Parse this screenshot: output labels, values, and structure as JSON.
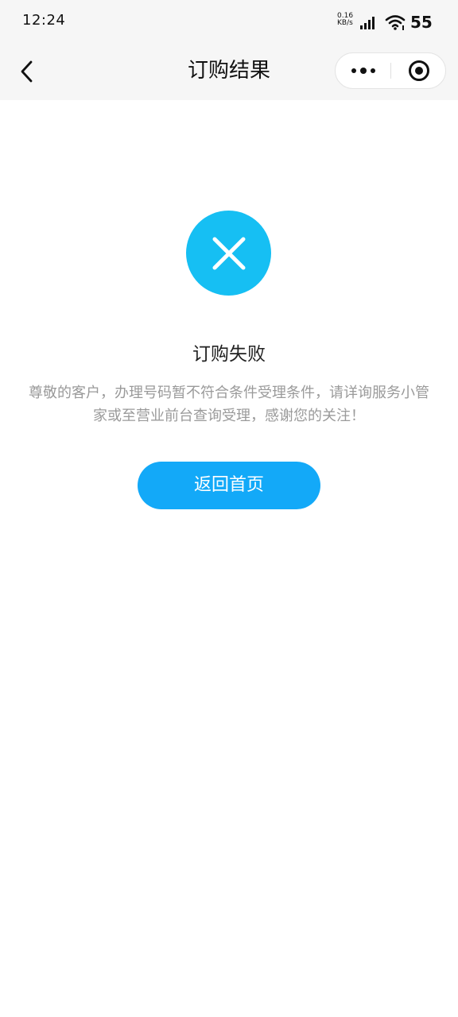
{
  "status_bar": {
    "time": "12:24",
    "net_speed_value": "0.16",
    "net_speed_unit": "KB/s",
    "battery": "55",
    "icons": [
      "signal-icon",
      "wifi-icon"
    ]
  },
  "nav": {
    "title": "订购结果",
    "back_icon": "chevron-left-icon",
    "more_icon": "more-dots-icon",
    "close_icon": "target-close-icon"
  },
  "result": {
    "icon": "close-x-icon",
    "icon_color": "#16bff3",
    "title": "订购失败",
    "description": "尊敬的客户，办理号码暂不符合条件受理条件，请详询服务小管家或至营业前台查询受理，感谢您的关注！"
  },
  "actions": {
    "home_label": "返回首页",
    "home_color": "#13a9f8"
  }
}
